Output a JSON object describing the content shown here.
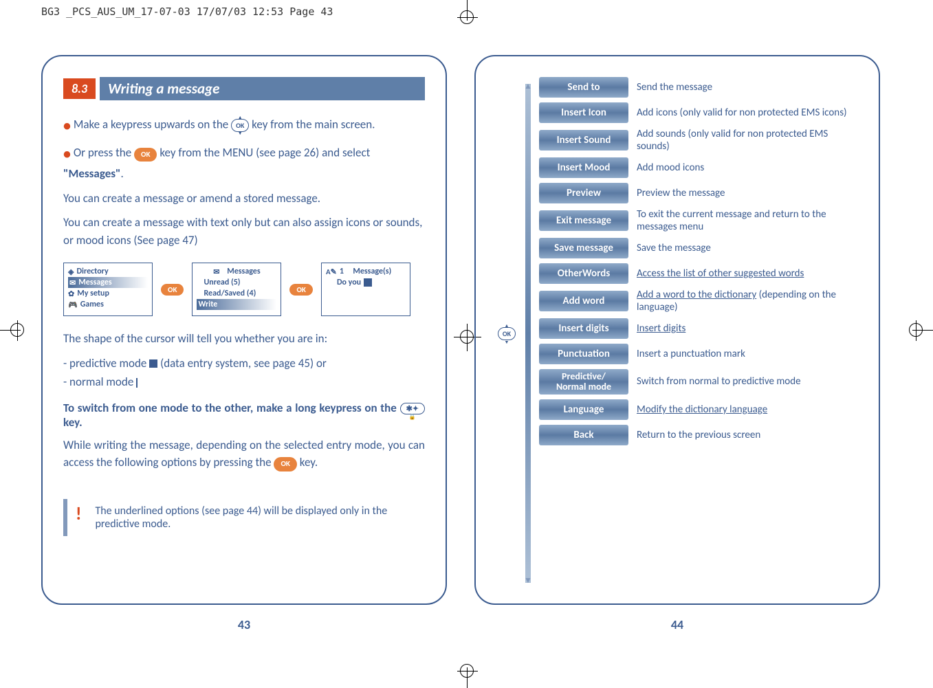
{
  "header_info": "BG3 _PCS_AUS_UM_17-07-03  17/07/03  12:53  Page 43",
  "left": {
    "section_num": "8.3",
    "section_title": "Writing a message",
    "bullet1_a": "Make a keypress upwards on the ",
    "bullet1_b": " key from the main screen.",
    "bullet2_a": "Or press the ",
    "bullet2_b": " key from the MENU (see page 26) and select ",
    "bullet2_c": "\"Messages\"",
    "bullet2_d": ".",
    "para1": "You can create a message or amend a stored message.",
    "para2": "You can create a message with text only but can also assign icons or sounds, or mood icons (See page 47)",
    "screen1": {
      "line1": "Directory",
      "line2": "Messages",
      "line3": "My setup",
      "line4": "Games"
    },
    "screen2": {
      "title": "Messages",
      "line1": "Unread (5)",
      "line2": "Read/Saved (4)",
      "line3": "Write"
    },
    "screen3": {
      "title_a": "1",
      "title_b": "Message(s)",
      "line1": "Do you"
    },
    "ok_label": "OK",
    "cursor_intro": "The shape of the cursor will tell you whether you are in:",
    "cursor_pred": "- predictive mode ",
    "cursor_pred_b": " (data entry system, see page 45) or",
    "cursor_norm": "- normal mode ",
    "switch_text_a": "To switch from one mode to the other, make a long keypress on the ",
    "switch_text_b": " key.",
    "while_text_a": "While writing the message, depending on the selected entry mode, you can access the following options by pressing the ",
    "while_text_b": " key.",
    "note": "The underlined options (see page 44) will be displayed only in the predictive mode.",
    "page_num": "43",
    "star_content": "✱✦"
  },
  "right": {
    "ok_label": "OK",
    "options": [
      {
        "label": "Send to",
        "desc": "Send the message"
      },
      {
        "label": "Insert Icon",
        "desc": "Add icons (only valid for non protected EMS icons)"
      },
      {
        "label": "Insert Sound",
        "desc": "Add sounds  (only valid for non protected EMS sounds)"
      },
      {
        "label": "Insert Mood",
        "desc": "Add mood icons"
      },
      {
        "label": "Preview",
        "desc": "Preview the message"
      },
      {
        "label": "Exit message",
        "desc": "To exit the current message and return to the messages menu"
      },
      {
        "label": "Save message",
        "desc": "Save the message"
      },
      {
        "label": "OtherWords",
        "desc": "Access the list of other suggested words",
        "underline": true
      },
      {
        "label": "Add word",
        "desc_a": "Add a word to the dictionary",
        "desc_b": " (depending on the language)",
        "partial": true
      },
      {
        "label": "Insert digits",
        "desc": "Insert digits",
        "underline": true
      },
      {
        "label": "Punctuation",
        "desc": "Insert a punctuation mark"
      },
      {
        "label": "Predictive/ Normal mode",
        "desc": "Switch from normal to predictive mode",
        "twoline": true
      },
      {
        "label": "Language",
        "desc": "Modify the dictionary language",
        "underline": true
      },
      {
        "label": "Back",
        "desc": "Return to the previous screen"
      }
    ],
    "page_num": "44"
  }
}
